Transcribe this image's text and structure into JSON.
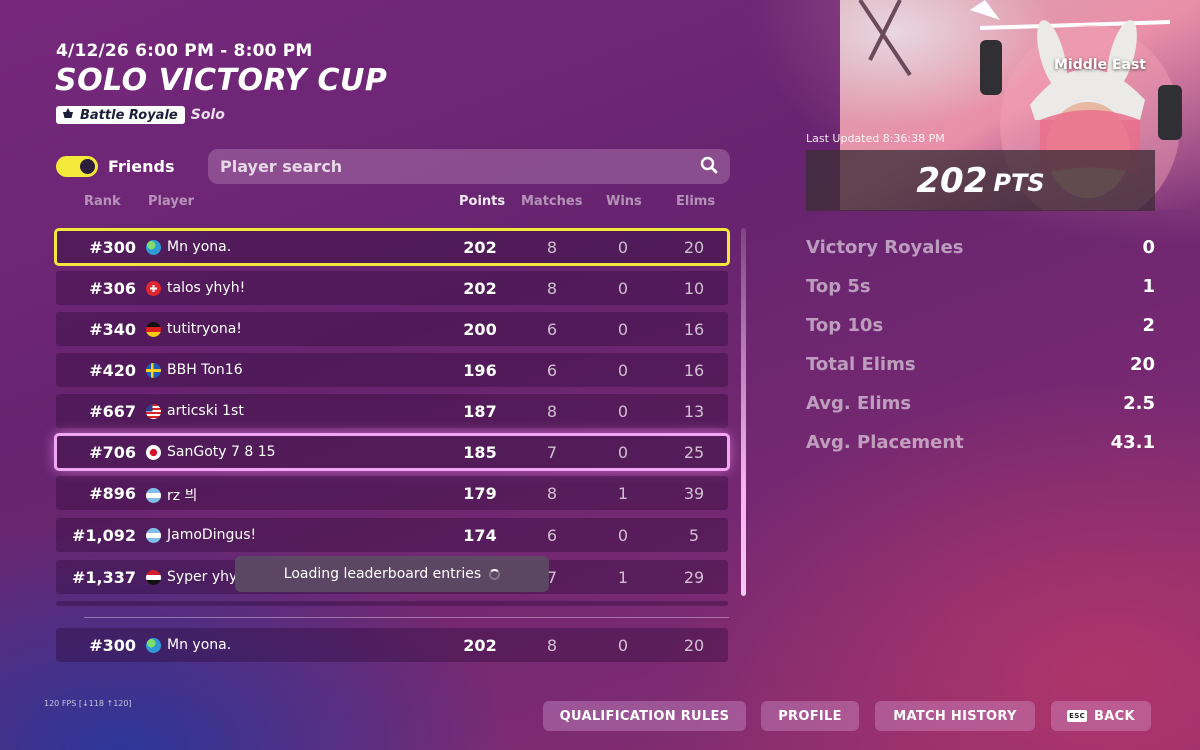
{
  "header": {
    "date": "4/12/26 6:00 PM - 8:00 PM",
    "title": "SOLO VICTORY CUP",
    "mode_badge": "Battle Royale",
    "mode_sub": "Solo"
  },
  "friends_toggle": {
    "label": "Friends",
    "on": true
  },
  "search": {
    "placeholder": "Player search",
    "value": ""
  },
  "columns": {
    "rank": "Rank",
    "player": "Player",
    "points": "Points",
    "matches": "Matches",
    "wins": "Wins",
    "elims": "Elims"
  },
  "rows": [
    {
      "rank": "#300",
      "flag": "globe",
      "player": "Mn yona.",
      "points": "202",
      "matches": "8",
      "wins": "0",
      "elims": "20",
      "selected": "yellow"
    },
    {
      "rank": "#306",
      "flag": "switzerland",
      "player": "talos yhyh!",
      "points": "202",
      "matches": "8",
      "wins": "0",
      "elims": "10"
    },
    {
      "rank": "#340",
      "flag": "germany",
      "player": "tutitryona!",
      "points": "200",
      "matches": "6",
      "wins": "0",
      "elims": "16"
    },
    {
      "rank": "#420",
      "flag": "sweden",
      "player": "BBH Ton16",
      "points": "196",
      "matches": "6",
      "wins": "0",
      "elims": "16"
    },
    {
      "rank": "#667",
      "flag": "usa",
      "player": "articski 1st",
      "points": "187",
      "matches": "8",
      "wins": "0",
      "elims": "13"
    },
    {
      "rank": "#706",
      "flag": "japan",
      "player": "SanGoty 7 8 15",
      "points": "185",
      "matches": "7",
      "wins": "0",
      "elims": "25",
      "selected": "pink"
    },
    {
      "rank": "#896",
      "flag": "argentina",
      "player": "rz 븨",
      "points": "179",
      "matches": "8",
      "wins": "1",
      "elims": "39"
    },
    {
      "rank": "#1,092",
      "flag": "argentina",
      "player": "JamoDingus!",
      "points": "174",
      "matches": "6",
      "wins": "0",
      "elims": "5"
    },
    {
      "rank": "#1,337",
      "flag": "egypt",
      "player": "Syper yhy",
      "points": "",
      "matches": "7",
      "wins": "1",
      "elims": "29"
    }
  ],
  "loading": {
    "text": "Loading leaderboard entries"
  },
  "self_row": {
    "rank": "#300",
    "flag": "globe",
    "player": "Mn yona.",
    "points": "202",
    "matches": "8",
    "wins": "0",
    "elims": "20"
  },
  "panel": {
    "region": "Middle East",
    "last_updated": "Last Updated 8:36:38 PM",
    "points": "202",
    "points_unit": "PTS",
    "stats": [
      {
        "label": "Victory Royales",
        "value": "0"
      },
      {
        "label": "Top 5s",
        "value": "1"
      },
      {
        "label": "Top 10s",
        "value": "2"
      },
      {
        "label": "Total Elims",
        "value": "20"
      },
      {
        "label": "Avg. Elims",
        "value": "2.5"
      },
      {
        "label": "Avg. Placement",
        "value": "43.1"
      }
    ]
  },
  "footer": {
    "fps": "120 FPS [↓118 ↑120]",
    "buttons": {
      "qualification": "QUALIFICATION RULES",
      "profile": "PROFILE",
      "history": "MATCH HISTORY",
      "back": "BACK",
      "back_key": "ESC"
    }
  },
  "colors": {
    "accent_yellow": "#f2e83b",
    "accent_pink": "#f2a6f6",
    "bg_purple": "#6d2674"
  }
}
